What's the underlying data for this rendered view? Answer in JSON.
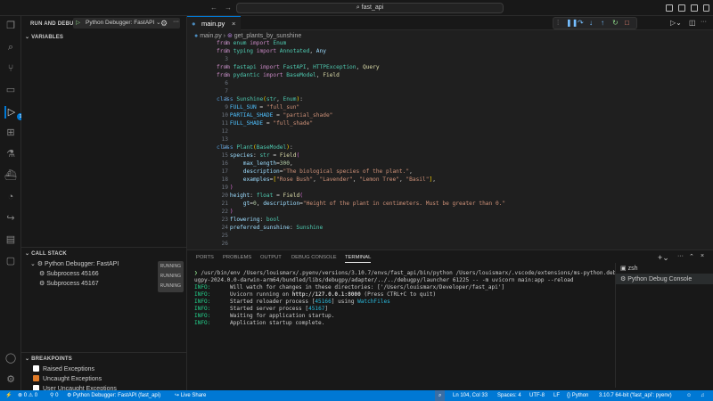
{
  "titlebar": {
    "search": "fast_api",
    "back": "←",
    "forward": "→"
  },
  "sidebar": {
    "title": "RUN AND DEBUG",
    "config": "Python Debugger: FastAPI",
    "variables": "VARIABLES",
    "call_stack": {
      "title": "CALL STACK",
      "items": [
        {
          "label": "Python Debugger: FastAPI",
          "status": "RUNNING"
        },
        {
          "label": "Subprocess 45166",
          "status": "RUNNING"
        },
        {
          "label": "Subprocess 45167",
          "status": "RUNNING"
        }
      ]
    },
    "breakpoints": {
      "title": "BREAKPOINTS",
      "items": [
        {
          "label": "Raised Exceptions",
          "checked": false
        },
        {
          "label": "Uncaught Exceptions",
          "checked": true
        },
        {
          "label": "User Uncaught Exceptions",
          "checked": false
        }
      ]
    }
  },
  "activity": {
    "debug_badge": "1"
  },
  "editor": {
    "tab": "main.py",
    "breadcrumb": {
      "file": "main.py",
      "symbol": "get_plants_by_sunshine"
    },
    "lines": [
      [
        [
          "from",
          "kw"
        ],
        [
          " enum ",
          "mod"
        ],
        [
          "import",
          "kw"
        ],
        [
          " Enum",
          "cls"
        ]
      ],
      [
        [
          "from",
          "kw"
        ],
        [
          " typing ",
          "mod"
        ],
        [
          "import",
          "kw"
        ],
        [
          " Annotated",
          "cls"
        ],
        [
          ", ",
          "pl"
        ],
        [
          "Any",
          "var"
        ]
      ],
      [],
      [
        [
          "from",
          "kw"
        ],
        [
          " fastapi ",
          "mod"
        ],
        [
          "import",
          "kw"
        ],
        [
          " FastAPI",
          "cls"
        ],
        [
          ", ",
          "pl"
        ],
        [
          "HTTPException",
          "cls"
        ],
        [
          ", ",
          "pl"
        ],
        [
          "Query",
          "fn"
        ]
      ],
      [
        [
          "from",
          "kw"
        ],
        [
          " pydantic ",
          "mod"
        ],
        [
          "import",
          "kw"
        ],
        [
          " BaseModel",
          "cls"
        ],
        [
          ", ",
          "pl"
        ],
        [
          "Field",
          "fn"
        ]
      ],
      [],
      [],
      [
        [
          "class",
          "kw2"
        ],
        [
          " Sunshine",
          "cls"
        ],
        [
          "(",
          "br"
        ],
        [
          "str",
          "cls"
        ],
        [
          ", ",
          "pl"
        ],
        [
          "Enum",
          "cls"
        ],
        [
          ")",
          "br"
        ],
        [
          ":",
          "pl"
        ]
      ],
      [
        [
          "    FULL_SUN",
          "const"
        ],
        [
          " = ",
          "pl"
        ],
        [
          "\"full_sun\"",
          "str"
        ]
      ],
      [
        [
          "    PARTIAL_SHADE",
          "const"
        ],
        [
          " = ",
          "pl"
        ],
        [
          "\"partial_shade\"",
          "str"
        ]
      ],
      [
        [
          "    FULL_SHADE",
          "const"
        ],
        [
          " = ",
          "pl"
        ],
        [
          "\"full_shade\"",
          "str"
        ]
      ],
      [],
      [],
      [
        [
          "class",
          "kw2"
        ],
        [
          " Plant",
          "cls"
        ],
        [
          "(",
          "br"
        ],
        [
          "BaseModel",
          "cls"
        ],
        [
          ")",
          "br"
        ],
        [
          ":",
          "pl"
        ]
      ],
      [
        [
          "    species",
          "var"
        ],
        [
          ": ",
          "pl"
        ],
        [
          "str",
          "cls"
        ],
        [
          " = ",
          "pl"
        ],
        [
          "Field",
          "fn"
        ],
        [
          "(",
          "br2"
        ]
      ],
      [
        [
          "        max_length",
          "var"
        ],
        [
          "=",
          "pl"
        ],
        [
          "300",
          "num"
        ],
        [
          ",",
          "pl"
        ]
      ],
      [
        [
          "        description",
          "var"
        ],
        [
          "=",
          "pl"
        ],
        [
          "\"The biological species of the plant.\"",
          "str"
        ],
        [
          ",",
          "pl"
        ]
      ],
      [
        [
          "        examples",
          "var"
        ],
        [
          "=",
          "pl"
        ],
        [
          "[",
          "br"
        ],
        [
          "\"Rose Bush\"",
          "str"
        ],
        [
          ", ",
          "pl"
        ],
        [
          "\"Lavender\"",
          "str"
        ],
        [
          ", ",
          "pl"
        ],
        [
          "\"Lemon Tree\"",
          "str"
        ],
        [
          ", ",
          "pl"
        ],
        [
          "\"Basil\"",
          "str"
        ],
        [
          "]",
          "br"
        ],
        [
          ",",
          "pl"
        ]
      ],
      [
        [
          "    )",
          "br2"
        ]
      ],
      [
        [
          "    height",
          "var"
        ],
        [
          ": ",
          "pl"
        ],
        [
          "float",
          "cls"
        ],
        [
          " = ",
          "pl"
        ],
        [
          "Field",
          "fn"
        ],
        [
          "(",
          "br2"
        ]
      ],
      [
        [
          "        gt",
          "var"
        ],
        [
          "=",
          "pl"
        ],
        [
          "0",
          "num"
        ],
        [
          ", ",
          "pl"
        ],
        [
          "description",
          "var"
        ],
        [
          "=",
          "pl"
        ],
        [
          "\"Height of the plant in centimeters. Must be greater than 0.\"",
          "str"
        ]
      ],
      [
        [
          "    )",
          "br2"
        ]
      ],
      [
        [
          "    flowering",
          "var"
        ],
        [
          ": ",
          "pl"
        ],
        [
          "bool",
          "cls"
        ]
      ],
      [
        [
          "    preferred_sunshine",
          "var"
        ],
        [
          ": ",
          "pl"
        ],
        [
          "Sunshine",
          "cls"
        ]
      ],
      [],
      []
    ]
  },
  "panel": {
    "tabs": [
      "PORTS",
      "PROBLEMS",
      "OUTPUT",
      "DEBUG CONSOLE",
      "TERMINAL"
    ],
    "active_tab": "TERMINAL",
    "command": "/usr/bin/env /Users/louismarx/.pyenv/versions/3.10.7/envs/fast_api/bin/python /Users/louismarx/.vscode/extensions/ms-python.debugpy-2024.0.0-darwin-arm64/bundled/libs/debugpy/adapter/../../debugpy/launcher 61225 -- -m uvicorn main:app --reload",
    "prompt": "❯",
    "log": [
      {
        "level": "INFO:",
        "text": "Will watch for changes in these directories: ['/Users/louismarx/Developer/fast_api']"
      },
      {
        "level": "INFO:",
        "pre": "Uvicorn running on ",
        "bold": "http://127.0.0.1:8000",
        "text": " (Press CTRL+C to quit)"
      },
      {
        "level": "INFO:",
        "pre": "Started reloader process [",
        "link": "45166",
        "mid": "] using ",
        "link2": "WatchFiles"
      },
      {
        "level": "INFO:",
        "pre": "Started server process [",
        "link": "45167",
        "mid": "]"
      },
      {
        "level": "INFO:",
        "text": "Waiting for application startup."
      },
      {
        "level": "INFO:",
        "text": "Application startup complete."
      }
    ],
    "terminals": [
      "zsh",
      "Python Debug Console"
    ]
  },
  "statusbar": {
    "errors": "0",
    "warnings": "0",
    "ports": "0",
    "debug": "Python Debugger: FastAPI (fast_api)",
    "liveshare": "Live Share",
    "position": "Ln 104, Col 33",
    "spaces": "Spaces: 4",
    "encoding": "UTF-8",
    "eol": "LF",
    "language": "Python",
    "interpreter": "3.10.7 64-bit ('fast_api': pyenv)"
  },
  "colors": {
    "accent": "#0078d4",
    "status_bar": "#0078d4",
    "checkbox": "#e07b29"
  }
}
